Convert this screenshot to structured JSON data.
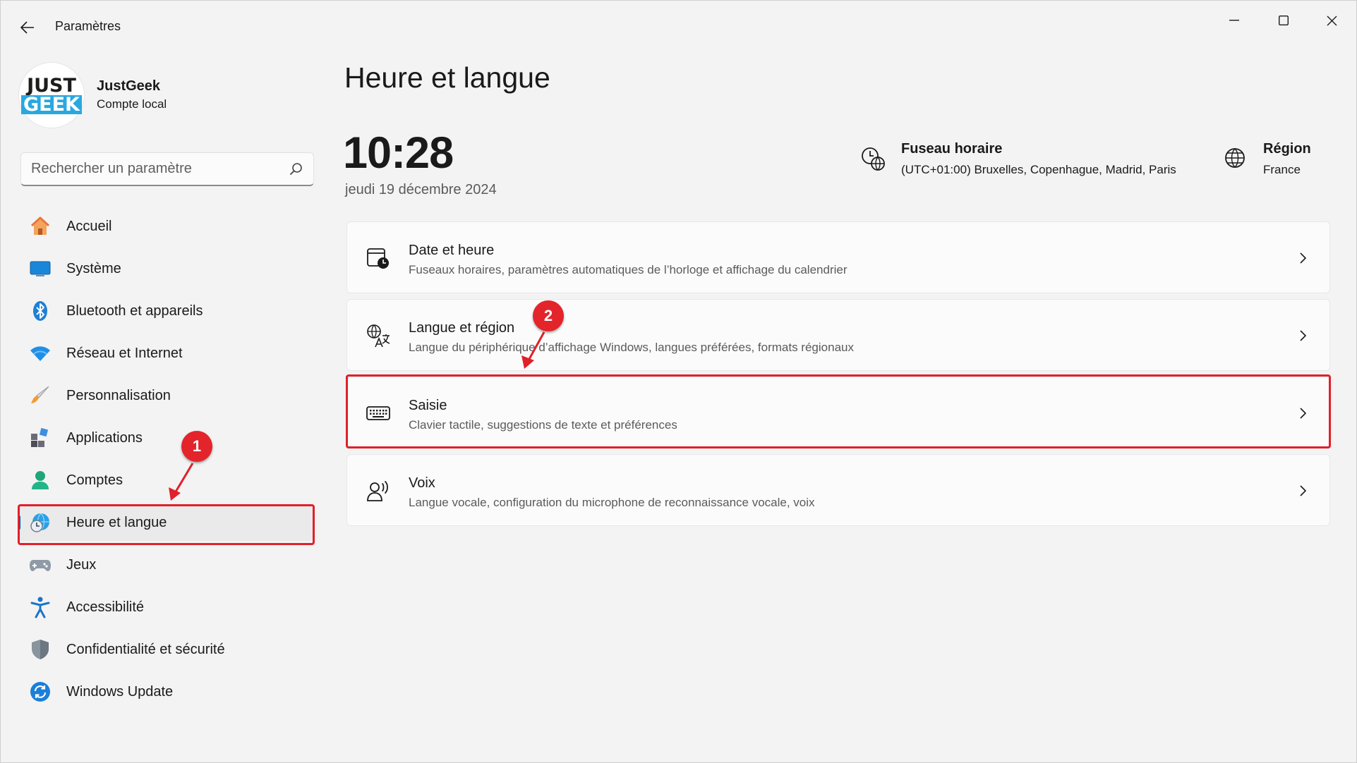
{
  "window": {
    "title": "Paramètres"
  },
  "profile": {
    "logo_top": "JUST",
    "logo_bottom": "GEEK",
    "name": "JustGeek",
    "account_type": "Compte local"
  },
  "search": {
    "placeholder": "Rechercher un paramètre"
  },
  "sidebar": {
    "items": [
      {
        "label": "Accueil",
        "icon": "home-icon"
      },
      {
        "label": "Système",
        "icon": "system-icon"
      },
      {
        "label": "Bluetooth et appareils",
        "icon": "bluetooth-icon"
      },
      {
        "label": "Réseau et Internet",
        "icon": "wifi-icon"
      },
      {
        "label": "Personnalisation",
        "icon": "brush-icon"
      },
      {
        "label": "Applications",
        "icon": "apps-icon"
      },
      {
        "label": "Comptes",
        "icon": "account-icon"
      },
      {
        "label": "Heure et langue",
        "icon": "time-language-icon",
        "selected": true
      },
      {
        "label": "Jeux",
        "icon": "gamepad-icon"
      },
      {
        "label": "Accessibilité",
        "icon": "accessibility-icon"
      },
      {
        "label": "Confidentialité et sécurité",
        "icon": "shield-icon"
      },
      {
        "label": "Windows Update",
        "icon": "update-icon"
      }
    ]
  },
  "main": {
    "title": "Heure et langue",
    "time": "10:28",
    "date": "jeudi 19 décembre 2024",
    "timezone": {
      "title": "Fuseau horaire",
      "value": "(UTC+01:00) Bruxelles, Copenhague, Madrid, Paris"
    },
    "region": {
      "title": "Région",
      "value": "France"
    },
    "cards": [
      {
        "title": "Date et heure",
        "subtitle": "Fuseaux horaires, paramètres automatiques de l’horloge et affichage du calendrier",
        "icon": "calendar-clock-icon"
      },
      {
        "title": "Langue et région",
        "subtitle": "Langue du périphérique d’affichage Windows, langues préférées, formats régionaux",
        "icon": "language-icon"
      },
      {
        "title": "Saisie",
        "subtitle": "Clavier tactile, suggestions de texte et préférences",
        "icon": "keyboard-icon"
      },
      {
        "title": "Voix",
        "subtitle": "Langue vocale, configuration du microphone de reconnaissance vocale, voix",
        "icon": "voice-icon"
      }
    ]
  },
  "annotations": {
    "badge_1": "1",
    "badge_2": "2",
    "color": "#e0202a"
  }
}
